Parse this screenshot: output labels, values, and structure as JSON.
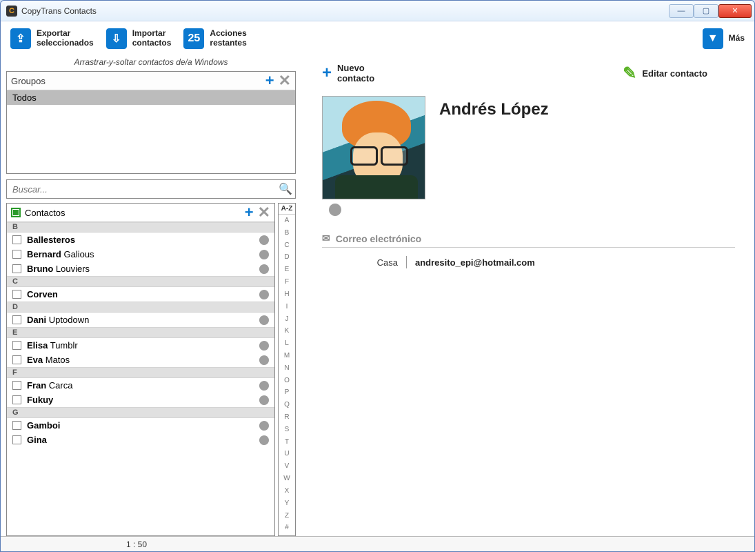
{
  "window": {
    "title": "CopyTrans Contacts"
  },
  "toolbar": {
    "export": {
      "line1": "Exportar",
      "line2": "seleccionados"
    },
    "import": {
      "line1": "Importar",
      "line2": "contactos"
    },
    "actions": {
      "count": "25",
      "line1": "Acciones",
      "line2": "restantes"
    },
    "more": "Más"
  },
  "hint": "Arrastrar-y-soltar contactos de/a Windows",
  "groups": {
    "label": "Groupos",
    "items": [
      {
        "name": "Todos",
        "selected": true
      }
    ]
  },
  "search": {
    "placeholder": "Buscar..."
  },
  "contacts_header": "Contactos",
  "alpha_head": "A-Z",
  "alpha": [
    "A",
    "B",
    "C",
    "D",
    "E",
    "F",
    "H",
    "I",
    "J",
    "K",
    "L",
    "M",
    "N",
    "O",
    "P",
    "Q",
    "R",
    "S",
    "T",
    "U",
    "V",
    "W",
    "X",
    "Y",
    "Z",
    "#"
  ],
  "sections": {
    "B": [
      {
        "bold": "Ballesteros",
        "rest": ""
      },
      {
        "bold": "Bernard",
        "rest": " Galious"
      },
      {
        "bold": "Bruno",
        "rest": " Louviers"
      }
    ],
    "C": [
      {
        "bold": "Corven",
        "rest": ""
      }
    ],
    "D": [
      {
        "bold": "Dani",
        "rest": " Uptodown"
      }
    ],
    "E": [
      {
        "bold": "Elisa",
        "rest": " Tumblr"
      },
      {
        "bold": "Eva",
        "rest": " Matos"
      }
    ],
    "F": [
      {
        "bold": "Fran",
        "rest": " Carca"
      },
      {
        "bold": "Fukuy",
        "rest": ""
      }
    ],
    "G": [
      {
        "bold": "Gamboi",
        "rest": ""
      },
      {
        "bold": "Gina",
        "rest": ""
      }
    ]
  },
  "right": {
    "new_line1": "Nuevo",
    "new_line2": "contacto",
    "edit": "Editar contacto",
    "name": "Andrés López",
    "email_section": "Correo electrónico",
    "email_label": "Casa",
    "email_value": "andresito_epi@hotmail.com"
  },
  "status": {
    "count": "1 : 50"
  }
}
